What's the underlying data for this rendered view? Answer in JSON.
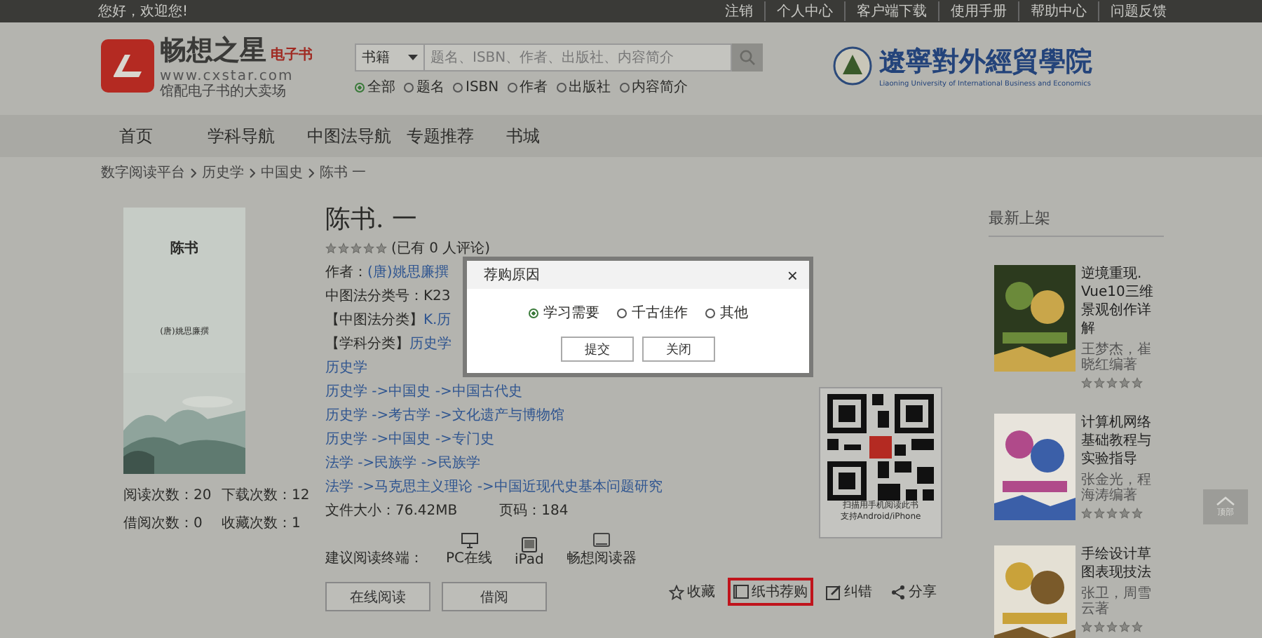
{
  "top_bar": {
    "greeting": "您好，欢迎您!",
    "links": [
      "注销",
      "个人中心",
      "客户端下载",
      "使用手册",
      "帮助中心",
      "问题反馈"
    ]
  },
  "header": {
    "logo": {
      "name": "畅想之星",
      "tag": "电子书",
      "url": "www.cxstar.com",
      "slogan": "馆配电子书的大卖场"
    },
    "search": {
      "category": "书籍",
      "placeholder": "题名、ISBN、作者、出版社、内容简介",
      "scopes": [
        {
          "label": "全部",
          "selected": true
        },
        {
          "label": "题名",
          "selected": false
        },
        {
          "label": "ISBN",
          "selected": false
        },
        {
          "label": "作者",
          "selected": false
        },
        {
          "label": "出版社",
          "selected": false
        },
        {
          "label": "内容简介",
          "selected": false
        }
      ]
    },
    "institution": {
      "name": "遼寧對外經貿學院",
      "english": "Liaoning University of International Business and Economics"
    }
  },
  "nav": [
    "首页",
    "学科导航",
    "中图法导航",
    "专题推荐",
    "书城"
  ],
  "breadcrumb": [
    "数字阅读平台",
    "历史学",
    "中国史",
    "陈书 一"
  ],
  "book": {
    "cover": {
      "title": "陈书",
      "author": "(唐)姚思廉撰"
    },
    "stats": [
      {
        "label": "阅读次数：",
        "value": "20"
      },
      {
        "label": "下载次数：",
        "value": "12"
      },
      {
        "label": "借阅次数：",
        "value": "0"
      },
      {
        "label": "收藏次数：",
        "value": "1"
      }
    ],
    "title": "陈书. 一",
    "stars": 0,
    "reviews": "(已有 0 人评论)",
    "author_label": "作者：",
    "author": "(唐)姚思廉撰",
    "class_no": "中图法分类号：K23",
    "clc_label": "【中图法分类】",
    "clc": "K.历",
    "subject_label": "【学科分类】",
    "subject": "历史学",
    "subject_paths": [
      "历史学",
      "历史学 ->中国史 ->中国古代史",
      "历史学 ->考古学 ->文化遗产与博物馆",
      "历史学 ->中国史 ->专门史",
      "法学 ->民族学 ->民族学",
      "法学 ->马克思主义理论 ->中国近现代史基本问题研究"
    ],
    "file_size": "文件大小：76.42MB",
    "pages": "页码：184",
    "terminals_label": "建议阅读终端：",
    "terminals": [
      {
        "kind": "monitor",
        "label": "PC在线"
      },
      {
        "kind": "tablet",
        "label": "iPad"
      },
      {
        "kind": "reader",
        "label": "畅想阅读器"
      }
    ],
    "buttons": [
      "在线阅读",
      "借阅"
    ],
    "qr_caption": [
      "扫描用手机阅读此书",
      "支持Android/iPhone"
    ],
    "actions": [
      {
        "kind": "star",
        "label": "收藏",
        "highlighted": false
      },
      {
        "kind": "book",
        "label": "纸书荐购",
        "highlighted": true
      },
      {
        "kind": "edit",
        "label": "纠错",
        "highlighted": false
      },
      {
        "kind": "share",
        "label": "分享",
        "highlighted": false
      }
    ]
  },
  "dialog": {
    "title": "荐购原因",
    "close": "×",
    "options": [
      {
        "label": "学习需要",
        "selected": true
      },
      {
        "label": "千古佳作",
        "selected": false
      },
      {
        "label": "其他",
        "selected": false
      }
    ],
    "buttons": [
      "提交",
      "关闭"
    ]
  },
  "sidebar": {
    "title": "最新上架",
    "books": [
      {
        "title": "逆境重现. Vue10三维景观创作详解",
        "author": "王梦杰，崔晓红编著",
        "stars": 0
      },
      {
        "title": "计算机网络基础教程与实验指导",
        "author": "张金光，程海涛编著",
        "stars": 0
      },
      {
        "title": "手绘设计草图表现技法",
        "author": "张卫，周雪云著",
        "stars": 0
      }
    ]
  },
  "back_to_top": "顶部"
}
